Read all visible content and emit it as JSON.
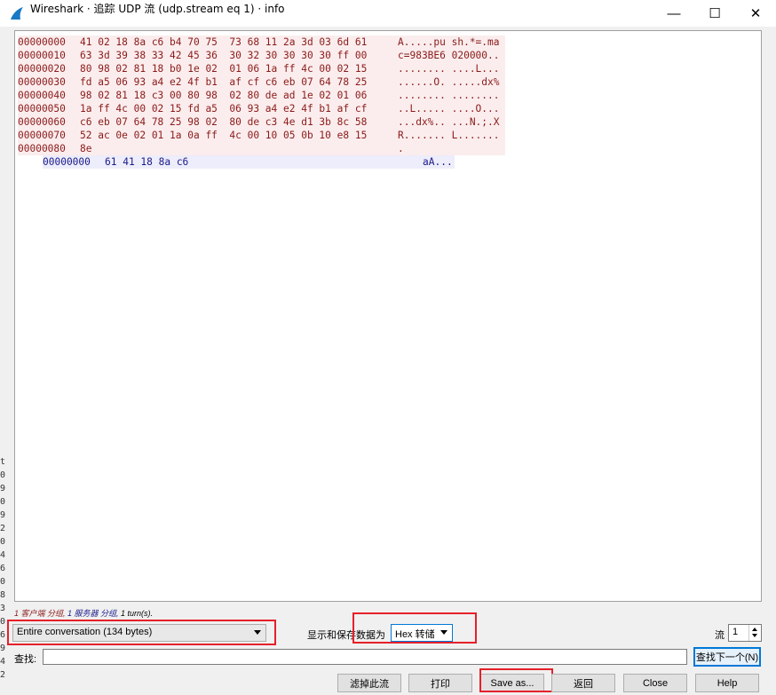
{
  "window": {
    "title": "Wireshark · 追踪 UDP 流 (udp.stream eq 1) · info",
    "minimize_glyph": "—",
    "maximize_glyph": "☐",
    "close_glyph": "✕",
    "left_edge_glyphs": [
      "t",
      "0",
      "9",
      "0",
      "9",
      "2",
      "0",
      "4",
      "6",
      "0",
      "8",
      "3",
      "0",
      "6",
      "9",
      "4",
      "2"
    ]
  },
  "stream": {
    "client_lines": [
      {
        "offset": "00000000",
        "bytes": "41 02 18 8a c6 b4 70 75  73 68 11 2a 3d 03 6d 61",
        "ascii": "A.....pu sh.*=.ma"
      },
      {
        "offset": "00000010",
        "bytes": "63 3d 39 38 33 42 45 36  30 32 30 30 30 30 ff 00",
        "ascii": "c=983BE6 020000.."
      },
      {
        "offset": "00000020",
        "bytes": "80 98 02 81 18 b0 1e 02  01 06 1a ff 4c 00 02 15",
        "ascii": "........ ....L..."
      },
      {
        "offset": "00000030",
        "bytes": "fd a5 06 93 a4 e2 4f b1  af cf c6 eb 07 64 78 25",
        "ascii": "......O. .....dx%"
      },
      {
        "offset": "00000040",
        "bytes": "98 02 81 18 c3 00 80 98  02 80 de ad 1e 02 01 06",
        "ascii": "........ ........"
      },
      {
        "offset": "00000050",
        "bytes": "1a ff 4c 00 02 15 fd a5  06 93 a4 e2 4f b1 af cf",
        "ascii": "..L..... ....O..."
      },
      {
        "offset": "00000060",
        "bytes": "c6 eb 07 64 78 25 98 02  80 de c3 4e d1 3b 8c 58",
        "ascii": "...dx%.. ...N.;.X"
      },
      {
        "offset": "00000070",
        "bytes": "52 ac 0e 02 01 1a 0a ff  4c 00 10 05 0b 10 e8 15",
        "ascii": "R....... L......."
      },
      {
        "offset": "00000080",
        "bytes": "8e",
        "ascii": "."
      }
    ],
    "server_lines": [
      {
        "offset": "00000000",
        "bytes": "61 41 18 8a c6",
        "ascii": "aA..."
      }
    ],
    "client_color": "#8b1a1a",
    "server_color": "#1a1a8b"
  },
  "summary": {
    "client_text": "1 客户端 分组, ",
    "server_text": "1 服务器 分组, ",
    "turns_text": "1 turn(s)."
  },
  "controls": {
    "conversation_select": "Entire conversation (134 bytes)",
    "display_label": "显示和保存数据为",
    "format_select": "Hex 转储",
    "stream_label": "流",
    "stream_value": "1",
    "find_label": "查找:",
    "find_value": "",
    "find_next_button": "查找下一个(N)"
  },
  "buttons": {
    "filter_out": "滤掉此流",
    "print": "打印",
    "save_as": "Save as...",
    "back": "返回",
    "close": "Close",
    "help": "Help"
  },
  "highlight_color": "#e5202a"
}
